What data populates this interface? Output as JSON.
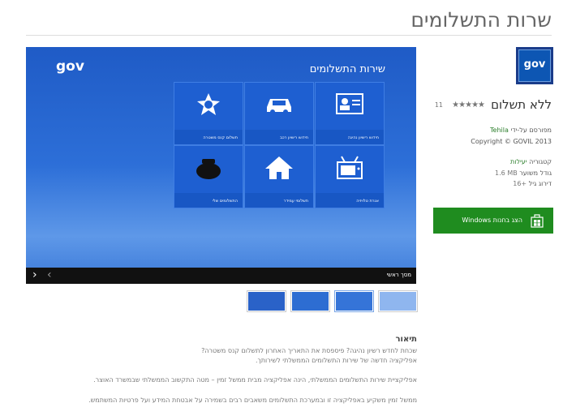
{
  "page": {
    "title": "שרות התשלומים"
  },
  "app": {
    "icon_text": "gov",
    "name": "ללא תשלום",
    "stars": "★★★★★",
    "rating_count": "11",
    "publisher_label": "מפורסם על-ידי",
    "publisher": "Tehila",
    "copyright": "Copyright © GOVIL 2013",
    "category_label": "קטגוריה",
    "category": "יעילות",
    "size_label": "גודל משוער",
    "size": "1.6 MB",
    "age_label": "דירוג גיל",
    "age": "16+",
    "cta_label": "הצג בחנות Windows"
  },
  "screenshot": {
    "logo": "gov",
    "title": "שירות התשלומים",
    "tiles": [
      {
        "label": "חידוש רישיון נהיגה",
        "icon": "driver-license-icon"
      },
      {
        "label": "חידוש רישיון רכב",
        "icon": "car-icon"
      },
      {
        "label": "תשלום קנס משטרה",
        "icon": "police-badge-icon"
      },
      {
        "label": "אגרת טלויזיה",
        "icon": "tv-icon"
      },
      {
        "label": "תשלומי עמידר",
        "icon": "house-icon"
      },
      {
        "label": "התשלומים שלי",
        "icon": "wallet-icon"
      }
    ],
    "nav_label": "מסך ראשי"
  },
  "description": {
    "heading": "תיאור",
    "lines": [
      "שכחת לחדש רשיון נהיגה? פיספסת את התאריך האחרון לתשלום קנס משטרה?",
      "אפליקציה חדשה של שירות התשלומים הממשלתי לשירותך.",
      "אפליקציית שירות התשלומים הממשלתי, הינה אפליקציה מבית ממשל זמין – מטה התקשוב הממשלתי שבמשרד האוצר.",
      "ממשל זמין משקיע באפליקציה זו ובמערכת התשלומים משאבים רבים בשמירה על אבטחת המידע ועל פרטיות המשתמש."
    ]
  }
}
